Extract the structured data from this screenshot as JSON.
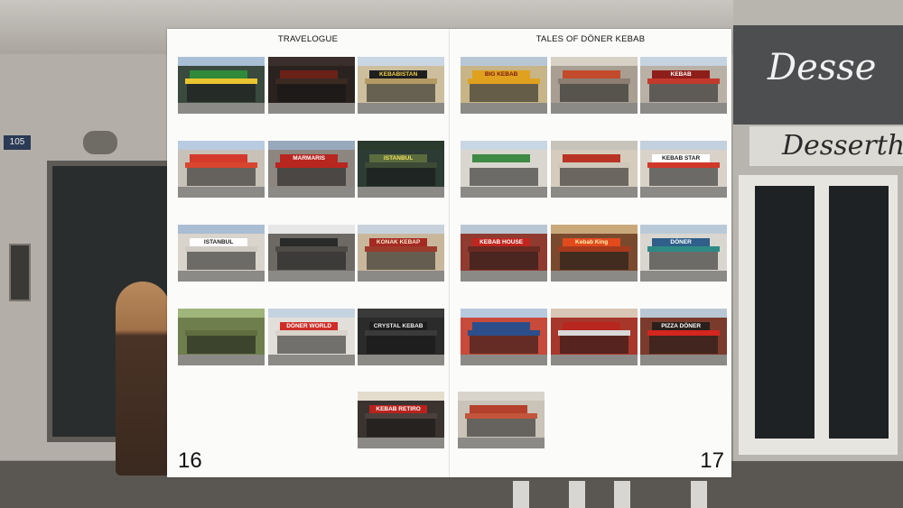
{
  "book": {
    "left_page": {
      "title": "TRAVELOGUE",
      "page_number": "16",
      "photos": [
        {
          "sign": "",
          "sky": "#a9bfd6",
          "facade": "#3a4a3e",
          "sign_bg": "#2f8a3a",
          "sign_fg": "#ffffff",
          "awning": "#e8c531"
        },
        {
          "sign": "",
          "sky": "#3a2f2a",
          "facade": "#2a221f",
          "sign_bg": "#6b2118",
          "sign_fg": "#e9d6c1",
          "awning": "#3a2a22"
        },
        {
          "sign": "KEBABISTAN",
          "sky": "#c9d6e4",
          "facade": "#cdbf9e",
          "sign_bg": "#1f1f1f",
          "sign_fg": "#f2d24a",
          "awning": "#b49a63"
        },
        {
          "sign": "",
          "sky": "#b9cbe0",
          "facade": "#c7c1b8",
          "sign_bg": "#d43a2c",
          "sign_fg": "#ffffff",
          "awning": "#d8452f"
        },
        {
          "sign": "MARMARIS",
          "sky": "#98a9bc",
          "facade": "#8d8680",
          "sign_bg": "#b7261f",
          "sign_fg": "#ffffff",
          "awning": "#b7261f"
        },
        {
          "sign": "ISTANBUL",
          "sky": "#2a3a2c",
          "facade": "#2c3b33",
          "sign_bg": "#5a6b3e",
          "sign_fg": "#f1e25b",
          "awning": "#3d4a36"
        },
        {
          "sign": "ISTANBUL",
          "sky": "#a9bdd3",
          "facade": "#d9d4cc",
          "sign_bg": "#ffffff",
          "sign_fg": "#1b1b1b",
          "awning": "#cfcac2"
        },
        {
          "sign": "",
          "sky": "#e6e6e6",
          "facade": "#6d6a66",
          "sign_bg": "#2a2a2a",
          "sign_fg": "#ffffff",
          "awning": "#4e4b47"
        },
        {
          "sign": "KONAK KEBAP",
          "sky": "#c8d2dc",
          "facade": "#c9b79c",
          "sign_bg": "#a52a22",
          "sign_fg": "#f6e7c9",
          "awning": "#9c3b2c"
        },
        {
          "sign": "",
          "sky": "#9fb57a",
          "facade": "#6e7f4d",
          "sign_bg": "#6e7f4d",
          "sign_fg": "#ffffff",
          "awning": "#5f6e3f"
        },
        {
          "sign": "DÖNER WORLD",
          "sky": "#c5d2df",
          "facade": "#e2dfda",
          "sign_bg": "#cf2d27",
          "sign_fg": "#ffffff",
          "awning": "#d8d3cb"
        },
        {
          "sign": "CRYSTAL KEBAB",
          "sky": "#3a3a3a",
          "facade": "#2b2b2b",
          "sign_bg": "#1d1d1d",
          "sign_fg": "#f0f0f0",
          "awning": "#3a3a3a"
        },
        {
          "sign": "KEBAB RETIRO",
          "sky": "#e4dccd",
          "facade": "#3a3330",
          "sign_bg": "#b8231d",
          "sign_fg": "#ffffff",
          "awning": "#4b403b"
        }
      ]
    },
    "right_page": {
      "title": "TALES OF DÖNER KEBAB",
      "page_number": "17",
      "photos": [
        {
          "sign": "BIG KEBAB",
          "sky": "#b8c7d6",
          "facade": "#c7b588",
          "sign_bg": "#e0a11f",
          "sign_fg": "#7a1a12",
          "awning": "#e0a11f"
        },
        {
          "sign": "",
          "sky": "#d7d0c4",
          "facade": "#a89f92",
          "sign_bg": "#c34a2a",
          "sign_fg": "#ffffff",
          "awning": "#8c7f72"
        },
        {
          "sign": "KEBAB",
          "sky": "#c6d3e1",
          "facade": "#b9b0a6",
          "sign_bg": "#8e1e1a",
          "sign_fg": "#ffffff",
          "awning": "#c23a2c"
        },
        {
          "sign": "",
          "sky": "#c9d6e3",
          "facade": "#d9d6cf",
          "sign_bg": "#3f8a45",
          "sign_fg": "#ffffff",
          "awning": "#d9d6cf"
        },
        {
          "sign": "",
          "sky": "#c8c4bc",
          "facade": "#d5ccbd",
          "sign_bg": "#b93424",
          "sign_fg": "#ffffff",
          "awning": "#cfc7ba"
        },
        {
          "sign": "KEBAB STAR",
          "sky": "#c3d0dd",
          "facade": "#d8d2c9",
          "sign_bg": "#ffffff",
          "sign_fg": "#1a1a1a",
          "awning": "#d0392a"
        },
        {
          "sign": "KEBAB HOUSE",
          "sky": "#b9c6d3",
          "facade": "#8f3b30",
          "sign_bg": "#c0261f",
          "sign_fg": "#ffffff",
          "awning": "#6a2a22"
        },
        {
          "sign": "Kebab King",
          "sky": "#c9a87a",
          "facade": "#7a4a2f",
          "sign_bg": "#e34b1c",
          "sign_fg": "#fff2b0",
          "awning": "#a63a1d"
        },
        {
          "sign": "DÖNER",
          "sky": "#b9c9d8",
          "facade": "#d9d6cf",
          "sign_bg": "#2f5f8a",
          "sign_fg": "#ffffff",
          "awning": "#2e8a85"
        },
        {
          "sign": "",
          "sky": "#b7c9dc",
          "facade": "#c74a3a",
          "sign_bg": "#2c4e8a",
          "sign_fg": "#ffffff",
          "awning": "#2c4e8a"
        },
        {
          "sign": "",
          "sky": "#d9c6b5",
          "facade": "#a8372b",
          "sign_bg": "#b8271f",
          "sign_fg": "#ffffff",
          "awning": "#d8d8d8"
        },
        {
          "sign": "PIZZA DÖNER",
          "sky": "#b9c7d5",
          "facade": "#7b3b2c",
          "sign_bg": "#2a1f1b",
          "sign_fg": "#ffffff",
          "awning": "#d3261f"
        },
        {
          "sign": "",
          "sky": "#d8d4cc",
          "facade": "#c9c3b8",
          "sign_bg": "#b5402c",
          "sign_fg": "#ffffff",
          "awning": "#c2553b"
        }
      ]
    }
  },
  "background": {
    "house_number": "105",
    "sign_top": "Desse",
    "sign_lower": "Desserth"
  }
}
